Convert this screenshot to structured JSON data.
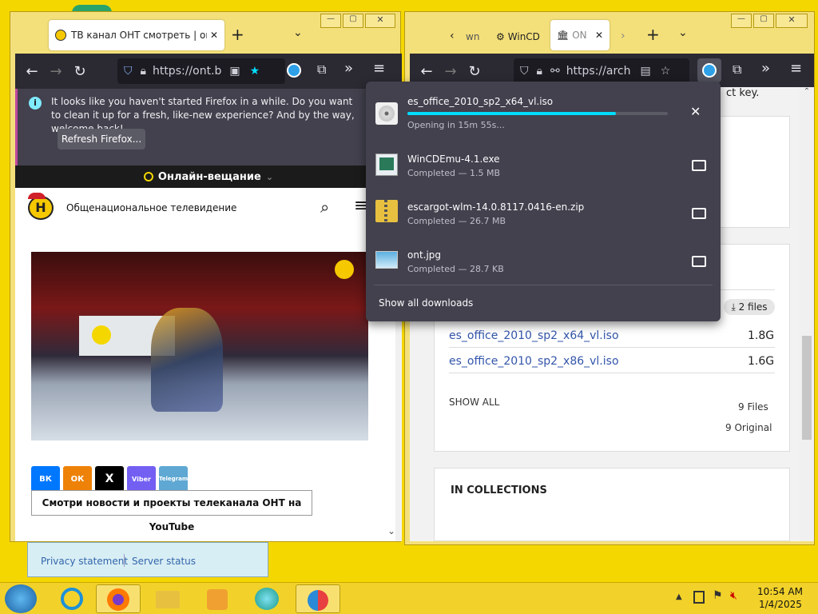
{
  "left_window": {
    "tab_title": "ТВ канал ОНТ смотреть | онлайн",
    "url": "https://ont.b",
    "notification": {
      "message": "It looks like you haven't started Firefox in a while. Do you want to clean it up for a fresh, like-new experience? And by the way, welcome back!",
      "button_label": "Refresh Firefox..."
    },
    "live_label": "Онлайн-вещание",
    "site_name": "Общенациональное телевидение",
    "share_buttons": [
      "ВК",
      "ОК",
      "X",
      "Viber",
      "Telegram"
    ],
    "youtube_button": "Смотри новости и проекты телеканала ОНТ на YouTube",
    "below_panel": {
      "privacy": "Privacy statement",
      "server": "Server status"
    }
  },
  "right_window": {
    "tabs": [
      "wn",
      "WinCD",
      "ON"
    ],
    "url": "https://arch",
    "partial_text": "ct key.",
    "files_badge": "2 files",
    "files": [
      {
        "name": "es_office_2010_sp2_x64_vl.iso",
        "size": "1.8G"
      },
      {
        "name": "es_office_2010_sp2_x86_vl.iso",
        "size": "1.6G"
      }
    ],
    "show_all": "SHOW ALL",
    "files_count": "9 Files",
    "original_count": "9 Original",
    "collections_heading": "IN COLLECTIONS"
  },
  "downloads": {
    "items": [
      {
        "name": "es_office_2010_sp2_x64_vl.iso",
        "status": "Opening in 15m 55s...",
        "progress": 0.8,
        "icon": "disc-icon",
        "action": "cancel"
      },
      {
        "name": "WinCDEmu-4.1.exe",
        "status": "Completed — 1.5 MB",
        "icon": "exe-icon",
        "action": "folder"
      },
      {
        "name": "escargot-wlm-14.0.8117.0416-en.zip",
        "status": "Completed — 26.7 MB",
        "icon": "zip-icon",
        "action": "folder"
      },
      {
        "name": "ont.jpg",
        "status": "Completed — 28.7 KB",
        "icon": "image-icon",
        "action": "folder"
      }
    ],
    "show_all_label": "Show all downloads"
  },
  "taskbar": {
    "time": "10:54 AM",
    "date": "1/4/2025"
  },
  "colors": {
    "desktop": "#f5d700",
    "browser_chrome": "#2b2a33",
    "panel": "#42414d",
    "progress": "#00ddff",
    "accent_link": "#3355aa"
  }
}
